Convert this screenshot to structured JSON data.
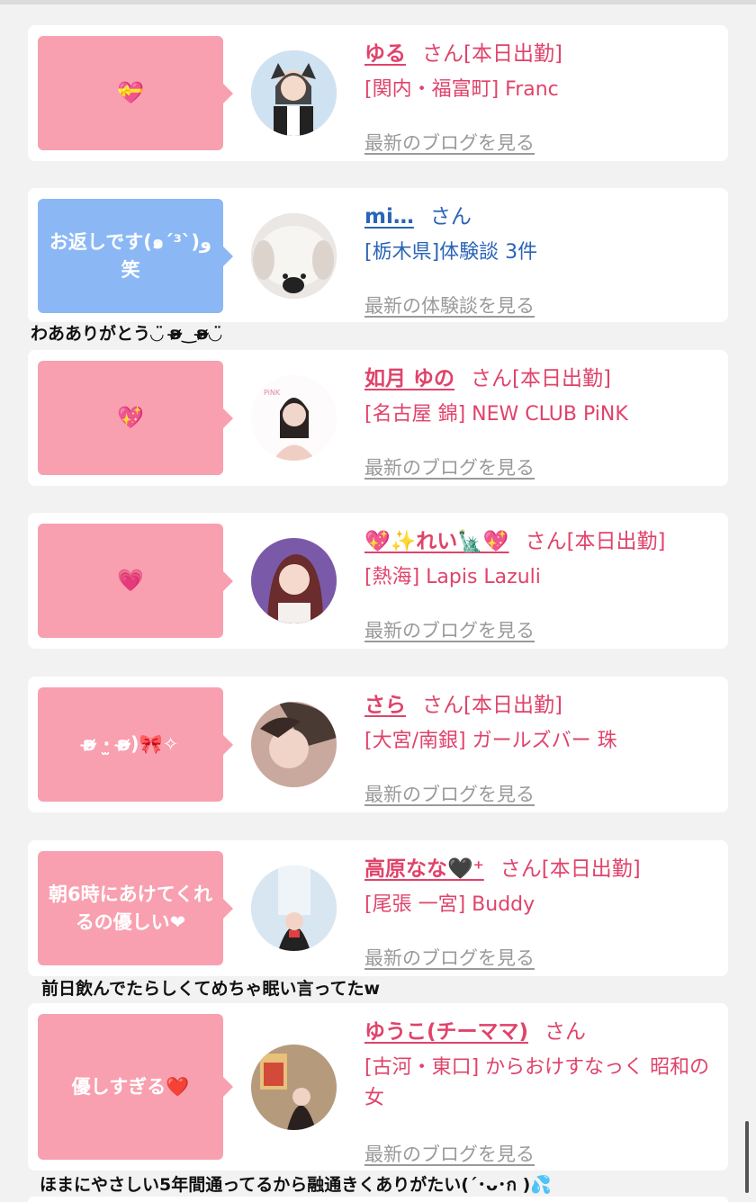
{
  "cards": [
    {
      "bubble": "💝",
      "bubble_color": "pink",
      "name": "ゆる",
      "suffix": "さん[本日出勤]",
      "shop": "[関内・福富町] Franc",
      "link": "最新のブログを見る",
      "name_color": "#e0436a"
    },
    {
      "bubble": "お返しです(๑´³`)و 笑",
      "bubble_color": "blue",
      "name": "mi…",
      "suffix": "さん",
      "shop": "[栃木県]体験談 3件",
      "link": "最新の体験談を見る",
      "name_color": "#2a64b7"
    },
    {
      "bubble": "💖",
      "bubble_color": "pink",
      "name": "如月 ゆの",
      "suffix": "さん[本日出勤]",
      "shop": "[名古屋 錦] NEW CLUB PiNK",
      "link": "最新のブログを見る",
      "name_color": "#e0436a"
    },
    {
      "bubble": "💗",
      "bubble_color": "pink",
      "name": "💖✨れい🗽💖",
      "suffix": "さん[本日出勤]",
      "shop": "[熱海] Lapis Lazuli",
      "link": "最新のブログを見る",
      "name_color": "#e0436a"
    },
    {
      "bubble": "ʚ̴̶̷̷ ·̫ ʚ̴̶̷̷)🎀✧",
      "bubble_color": "pink",
      "name": "さら",
      "suffix": "さん[本日出勤]",
      "shop": "[大宮/南銀] ガールズバー 珠",
      "link": "最新のブログを見る",
      "name_color": "#e0436a"
    },
    {
      "bubble": "朝6時にあけてくれるの優しい❤",
      "bubble_color": "pink",
      "name": "高原なな🖤⁺",
      "suffix": "さん[本日出勤]",
      "shop": "[尾張 一宮] Buddy",
      "link": "最新のブログを見る",
      "name_color": "#e0436a"
    },
    {
      "bubble": "優しすぎる❤️",
      "bubble_color": "pink",
      "name": "ゆうこ(チーママ)",
      "suffix": "さん",
      "shop": "[古河・東口] からおけすなっく 昭和の女",
      "link": "最新のブログを見る",
      "name_color": "#e0436a"
    }
  ],
  "notes": {
    "after_card_2": "わあありがとう◡̈ ʚ̴̶̷̷‿ʚ̴̶̷̷◡̈",
    "after_card_6": "前日飲んでたらしくてめちゃ眠い言ってたw",
    "after_card_7": "ほまにやさしい5年間通ってるから融通きくありがたい(´･ᴗ･ก )💦"
  },
  "colors": {
    "pink_bubble": "#f8a0b0",
    "blue_bubble": "#8bb8f5",
    "link_gray": "#9a9a9a"
  }
}
